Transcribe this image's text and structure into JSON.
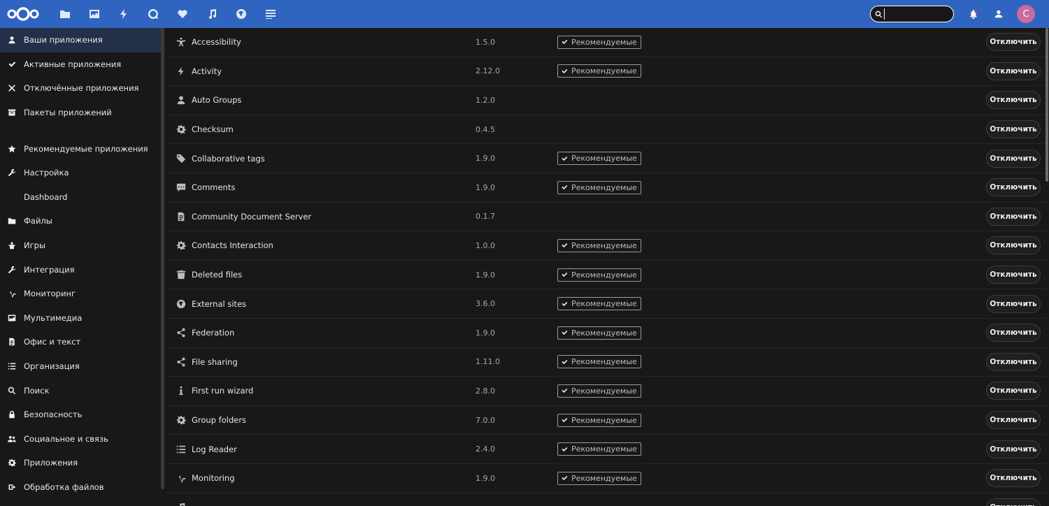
{
  "nav_apps": [
    "files-icon",
    "photos-icon",
    "activity-icon",
    "talk-icon",
    "favorites-icon",
    "music-icon",
    "web-icon",
    "notes-icon"
  ],
  "search": {
    "value": ""
  },
  "user": {
    "initial": "C"
  },
  "sidebar": {
    "top": [
      {
        "label": "Ваши приложения",
        "icon": "user-icon",
        "active": true
      },
      {
        "label": "Активные приложения",
        "icon": "check-icon"
      },
      {
        "label": "Отключённые приложения",
        "icon": "close-icon"
      },
      {
        "label": "Пакеты приложений",
        "icon": "bundle-icon"
      }
    ],
    "categories": [
      {
        "label": "Рекомендуемые приложения",
        "icon": "star-icon"
      },
      {
        "label": "Настройка",
        "icon": "wrench-icon"
      },
      {
        "label": "Dashboard",
        "icon": ""
      },
      {
        "label": "Файлы",
        "icon": "folder-icon"
      },
      {
        "label": "Игры",
        "icon": "games-icon"
      },
      {
        "label": "Интеграция",
        "icon": "wrench-icon"
      },
      {
        "label": "Мониторинг",
        "icon": "pulse-icon"
      },
      {
        "label": "Мультимедиа",
        "icon": "image-icon"
      },
      {
        "label": "Офис и текст",
        "icon": "document-icon"
      },
      {
        "label": "Организация",
        "icon": "list-icon"
      },
      {
        "label": "Поиск",
        "icon": "search-icon"
      },
      {
        "label": "Безопасность",
        "icon": "lock-icon"
      },
      {
        "label": "Социальное и связь",
        "icon": "users-icon"
      },
      {
        "label": "Приложения",
        "icon": "gear-icon"
      },
      {
        "label": "Обработка файлов",
        "icon": "workflow-icon"
      }
    ]
  },
  "apps": [
    {
      "name": "Accessibility",
      "version": "1.5.0",
      "recommended": true,
      "icon": "accessibility-icon"
    },
    {
      "name": "Activity",
      "version": "2.12.0",
      "recommended": true,
      "icon": "activity-icon"
    },
    {
      "name": "Auto Groups",
      "version": "1.2.0",
      "recommended": false,
      "icon": "user-icon"
    },
    {
      "name": "Checksum",
      "version": "0.4.5",
      "recommended": false,
      "icon": "gear-icon"
    },
    {
      "name": "Collaborative tags",
      "version": "1.9.0",
      "recommended": true,
      "icon": "tag-icon"
    },
    {
      "name": "Comments",
      "version": "1.9.0",
      "recommended": true,
      "icon": "comment-icon"
    },
    {
      "name": "Community Document Server",
      "version": "0.1.7",
      "recommended": false,
      "icon": "document-icon"
    },
    {
      "name": "Contacts Interaction",
      "version": "1.0.0",
      "recommended": true,
      "icon": "gear-icon"
    },
    {
      "name": "Deleted files",
      "version": "1.9.0",
      "recommended": true,
      "icon": "trash-icon"
    },
    {
      "name": "External sites",
      "version": "3.6.0",
      "recommended": true,
      "icon": "globe-icon"
    },
    {
      "name": "Federation",
      "version": "1.9.0",
      "recommended": true,
      "icon": "share-icon"
    },
    {
      "name": "File sharing",
      "version": "1.11.0",
      "recommended": true,
      "icon": "share-icon"
    },
    {
      "name": "First run wizard",
      "version": "2.8.0",
      "recommended": true,
      "icon": "info-icon"
    },
    {
      "name": "Group folders",
      "version": "7.0.0",
      "recommended": true,
      "icon": "gear-icon"
    },
    {
      "name": "Log Reader",
      "version": "2.4.0",
      "recommended": true,
      "icon": "list-icon"
    },
    {
      "name": "Monitoring",
      "version": "1.9.0",
      "recommended": true,
      "icon": "pulse-icon"
    },
    {
      "name": "",
      "version": "",
      "recommended": false,
      "icon": "music-icon"
    }
  ],
  "labels": {
    "recommended": "Рекомендуемые",
    "disable": "Отключить"
  },
  "colors": {
    "header": "#2f65c0",
    "background": "#181818",
    "active_item": "#233047",
    "avatar": "#c96b9c"
  }
}
